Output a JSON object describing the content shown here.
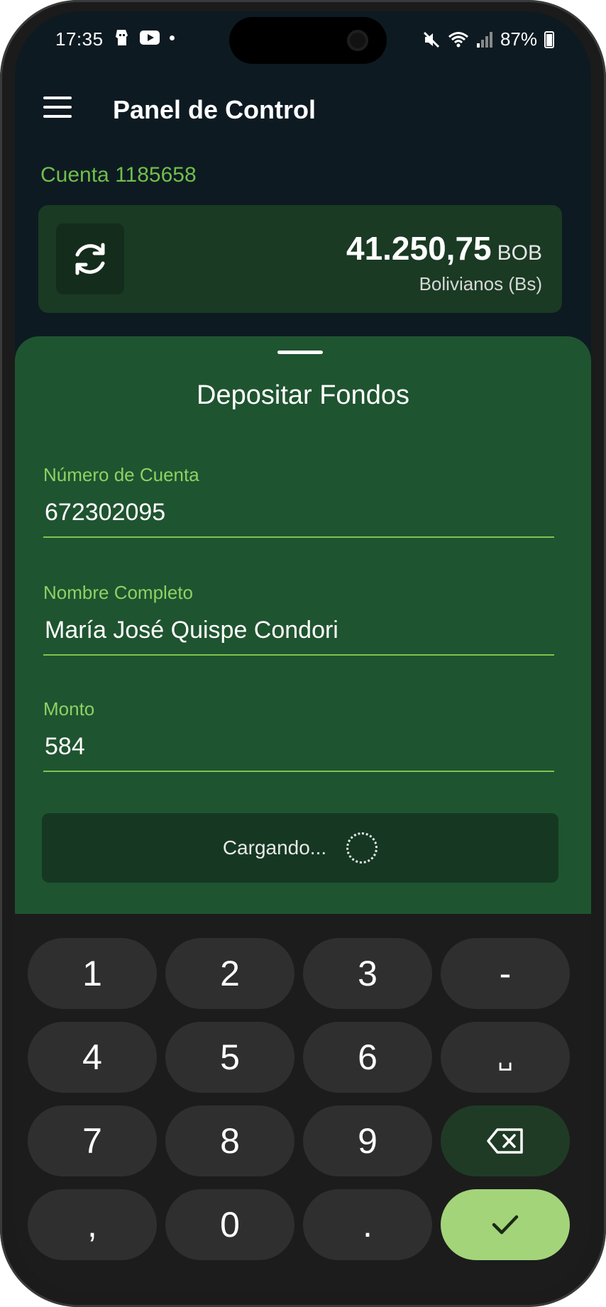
{
  "status_bar": {
    "time": "17:35",
    "battery": "87%"
  },
  "app_bar": {
    "title": "Panel de Control"
  },
  "account": {
    "label": "Cuenta 1185658",
    "balance": "41.250,75",
    "currency": "BOB",
    "currency_name": "Bolivianos (Bs)"
  },
  "sheet": {
    "title": "Depositar Fondos",
    "fields": [
      {
        "label": "Número de Cuenta",
        "value": "672302095"
      },
      {
        "label": "Nombre Completo",
        "value": "María José Quispe Condori"
      },
      {
        "label": "Monto",
        "value": "584"
      }
    ],
    "submit_label": "Cargando..."
  },
  "keypad": {
    "keys": [
      "1",
      "2",
      "3",
      "-",
      "4",
      "5",
      "6",
      "␣",
      "7",
      "8",
      "9",
      ",",
      "0",
      "."
    ]
  },
  "colors": {
    "accent_green": "#6fbf4a",
    "sheet_bg": "#1f5430",
    "confirm_key": "#a3d47a"
  }
}
